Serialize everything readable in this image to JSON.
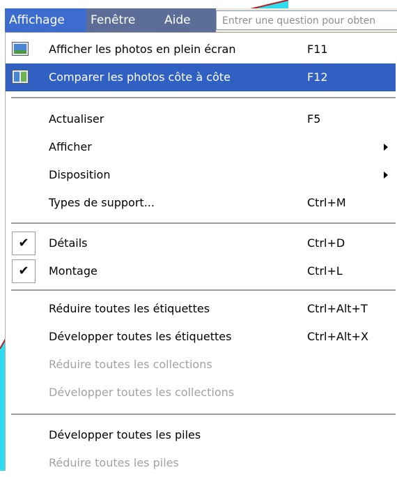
{
  "menubar": {
    "items": [
      "Affichage",
      "Fenêtre",
      "Aide"
    ],
    "help_placeholder": "Entrer une question pour obten"
  },
  "menu": {
    "groups": [
      [
        {
          "label": "Afficher les photos en plein écran",
          "shortcut": "F11",
          "icon": "fullscreen-photo-icon"
        },
        {
          "label": "Comparer les photos côte à côte",
          "shortcut": "F12",
          "icon": "side-by-side-photo-icon",
          "highlighted": true
        }
      ],
      [
        {
          "label": "Actualiser",
          "shortcut": "F5"
        },
        {
          "label": "Afficher",
          "submenu": true
        },
        {
          "label": "Disposition",
          "submenu": true
        },
        {
          "label": "Types de support...",
          "shortcut": "Ctrl+M"
        }
      ],
      [
        {
          "label": "Détails",
          "shortcut": "Ctrl+D",
          "checked": true,
          "check_glyph": "✔"
        },
        {
          "label": "Montage",
          "shortcut": "Ctrl+L",
          "checked": true,
          "check_glyph": "✔"
        }
      ],
      [
        {
          "label": "Réduire toutes les étiquettes",
          "shortcut": "Ctrl+Alt+T"
        },
        {
          "label": "Développer toutes les étiquettes",
          "shortcut": "Ctrl+Alt+X"
        },
        {
          "label": "Réduire toutes les collections",
          "disabled": true
        },
        {
          "label": "Développer toutes les collections",
          "disabled": true
        }
      ],
      [
        {
          "label": "Développer toutes les piles"
        },
        {
          "label": "Réduire toutes les piles",
          "disabled": true
        }
      ]
    ]
  },
  "colors": {
    "highlight": "#3160c3",
    "menubar_active": "#3d6ccf",
    "menubar_dark": "#5c6e97",
    "disabled_text": "#a2a2a2",
    "decoration_cyan": "#2fdcf0"
  }
}
